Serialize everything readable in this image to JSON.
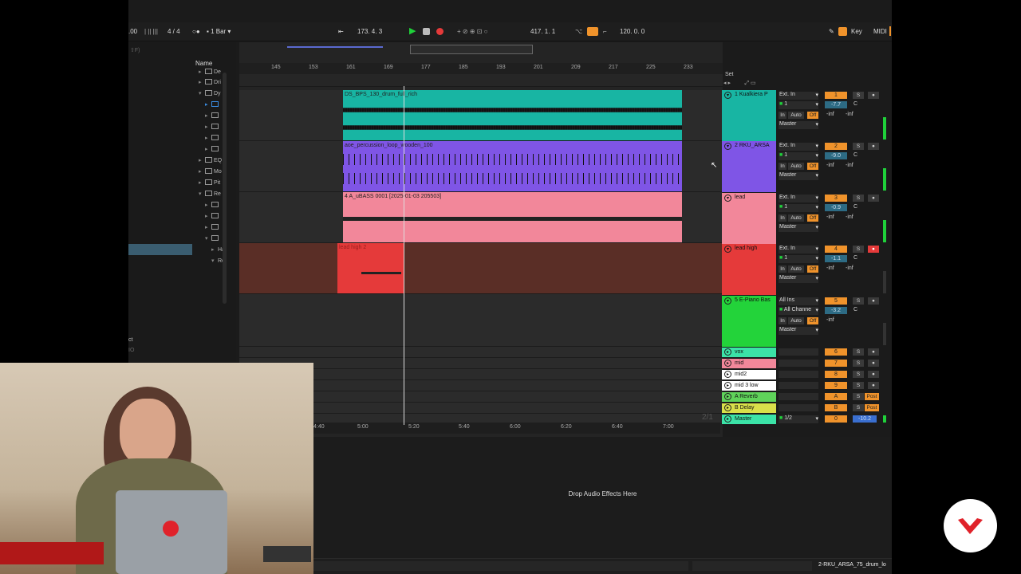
{
  "toolbar": {
    "left_value": ".00",
    "signature": "4 / 4",
    "quantize": "1 Bar",
    "position": "173.  4.  3",
    "loop_start": "417.  1.  1",
    "tempo_readout": "120.  0.  0",
    "key_label": "Key",
    "midi_label": "MIDI"
  },
  "browser": {
    "search_hint": "⇧F)",
    "header": "Name",
    "items": [
      "De",
      "Dri",
      "Dy",
      "",
      "",
      "",
      "",
      "",
      "EQ",
      "Mo",
      "Pit",
      "Re",
      "",
      "",
      "",
      "",
      "Ha",
      "Ro"
    ],
    "footer1": "ct",
    "footer2": "IO"
  },
  "ruler": {
    "bars": [
      "145",
      "153",
      "161",
      "169",
      "177",
      "185",
      "193",
      "201",
      "209",
      "217",
      "225",
      "233"
    ]
  },
  "timeline": {
    "times": [
      "4:40",
      "5:00",
      "5:20",
      "5:40",
      "6:00",
      "6:20",
      "6:40",
      "7:00"
    ],
    "overlay": "2/1"
  },
  "set_label": "Set",
  "clips": [
    {
      "name": "DS_BPS_130_drum_full_rich",
      "color": "#18b5a3"
    },
    {
      "name": "aoe_percussion_loop_wooden_100",
      "color": "#7f55e6"
    },
    {
      "name": "4 A_uBASS 0001 [2025-01-03 205503]",
      "color": "#f2879a"
    },
    {
      "name": "lead high 2",
      "color": "#e53a3a"
    }
  ],
  "tracks": [
    {
      "name": "1 Kualkiera P",
      "color": "#18b5a3",
      "input": "Ext. In",
      "channel": "1",
      "output": "Master",
      "num": "1",
      "vol": "-7.7",
      "pan": "C",
      "inf1": "-inf",
      "inf2": "-inf"
    },
    {
      "name": "2 RKU_ARSA",
      "color": "#7f55e6",
      "input": "Ext. In",
      "channel": "1",
      "output": "Master",
      "num": "2",
      "vol": "-9.0",
      "pan": "C",
      "inf1": "-inf",
      "inf2": "-inf"
    },
    {
      "name": "lead",
      "color": "#f2879a",
      "input": "Ext. In",
      "channel": "1",
      "output": "Master",
      "num": "3",
      "vol": "-0.9",
      "pan": "C",
      "inf1": "-inf",
      "inf2": "-inf"
    },
    {
      "name": "lead high",
      "color": "#e53a3a",
      "input": "Ext. In",
      "channel": "1",
      "output": "Master",
      "num": "4",
      "vol": "-1.1",
      "pan": "C",
      "inf1": "-inf",
      "inf2": "-inf"
    },
    {
      "name": "5 E-Piano Bas",
      "color": "#23d33a",
      "input": "All Ins",
      "channel": "All Channe",
      "output": "Master",
      "num": "5",
      "vol": "-3.2",
      "pan": "C",
      "inf1": "-inf",
      "inf2": ""
    }
  ],
  "small_tracks": [
    {
      "name": "vox",
      "color": "#3be3a7",
      "num": "6",
      "s": "S"
    },
    {
      "name": "mid",
      "color": "#f2879a",
      "num": "7",
      "s": "S"
    },
    {
      "name": "mid2",
      "color": "#ffffff",
      "num": "8",
      "s": "S"
    },
    {
      "name": "mid 3 low",
      "color": "#ffffff",
      "num": "9",
      "s": "S"
    },
    {
      "name": "A Reverb",
      "color": "#5fd35a",
      "num": "A",
      "s": "S",
      "post": "Post"
    },
    {
      "name": "B Delay",
      "color": "#d9e04a",
      "num": "B",
      "s": "S",
      "post": "Post"
    },
    {
      "name": "Master",
      "color": "#3be3a7",
      "num": "0",
      "s": "",
      "master_out": "1/2",
      "master_vol": "-10.2"
    }
  ],
  "mon_labels": {
    "in": "In",
    "auto": "Auto",
    "off": "Off"
  },
  "detail": {
    "drop_text": "Drop Audio Effects Here"
  },
  "status": {
    "right_text": "2-RKU_ARSA_75_drum_lo"
  },
  "colors": {
    "accent": "#f0932b",
    "play": "#1fd13a",
    "record": "#e53a3a",
    "volume": "#2d6b84"
  }
}
